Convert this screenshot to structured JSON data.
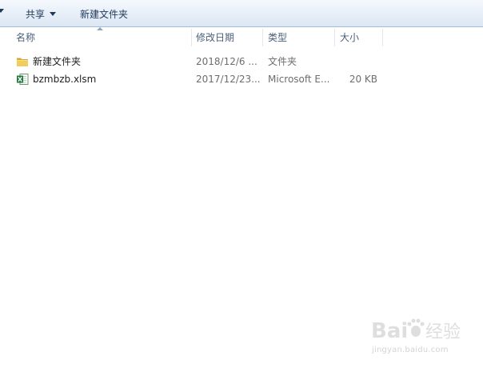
{
  "toolbar": {
    "share_label": "共享",
    "new_folder_label": "新建文件夹"
  },
  "columns": {
    "name": "名称",
    "date": "修改日期",
    "type": "类型",
    "size": "大小"
  },
  "files": [
    {
      "icon": "folder-icon",
      "name": "新建文件夹",
      "date": "2018/12/6 ...",
      "type": "文件夹",
      "size": ""
    },
    {
      "icon": "excel-file-icon",
      "name": "bzmbzb.xlsm",
      "date": "2017/12/23...",
      "type": "Microsoft E...",
      "size": "20 KB"
    }
  ],
  "watermark": {
    "caption": "jingyan.baidu.com"
  },
  "colors": {
    "toolbar_text": "#1e395b",
    "header_text": "#4c607a",
    "folder": "#e8c152",
    "excel": "#1f7a3d"
  }
}
